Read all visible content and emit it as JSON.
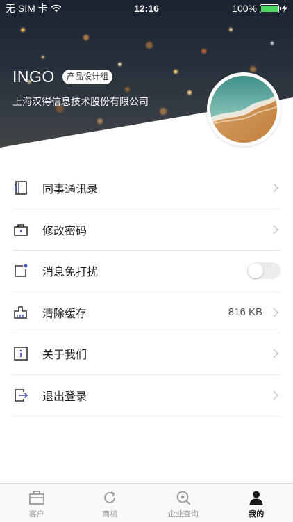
{
  "status_bar": {
    "carrier": "无 SIM 卡",
    "time": "12:16",
    "battery": "100%"
  },
  "profile": {
    "name": "INGO",
    "role_badge": "产品设计组",
    "company": "上海汉得信息技术股份有限公司"
  },
  "menu": [
    {
      "label": "同事通讯录",
      "icon": "contacts-book-icon"
    },
    {
      "label": "修改密码",
      "icon": "briefcase-lock-icon"
    },
    {
      "label": "消息免打扰",
      "icon": "notification-icon",
      "toggle": false
    },
    {
      "label": "清除缓存",
      "icon": "broom-icon",
      "value": "816 KB"
    },
    {
      "label": "关于我们",
      "icon": "info-icon"
    },
    {
      "label": "退出登录",
      "icon": "logout-icon"
    }
  ],
  "tabbar": {
    "tabs": [
      {
        "label": "客户",
        "icon": "briefcase-icon",
        "active": false
      },
      {
        "label": "商机",
        "icon": "refresh-icon",
        "active": false
      },
      {
        "label": "企业查询",
        "icon": "search-icon",
        "active": false
      },
      {
        "label": "我的",
        "icon": "person-icon",
        "active": true
      }
    ]
  },
  "colors": {
    "accent": "#3f51b5",
    "toggle_off": "#ececec",
    "battery": "#4cd964"
  }
}
